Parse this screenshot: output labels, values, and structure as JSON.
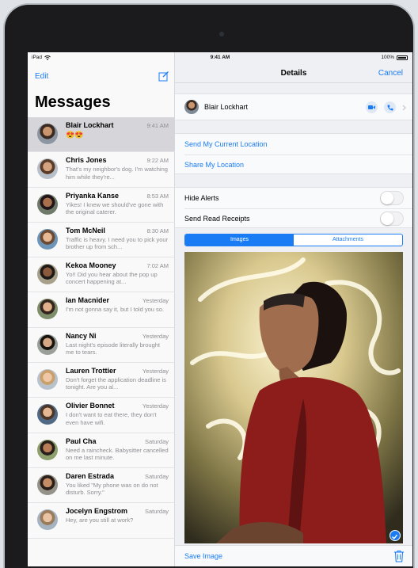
{
  "status_bar": {
    "device": "iPad",
    "time": "9:41 AM",
    "battery": "100%"
  },
  "sidebar": {
    "edit_label": "Edit",
    "title": "Messages",
    "conversations": [
      {
        "name": "Blair Lockhart",
        "time": "9:41 AM",
        "preview": "😍😍",
        "selected": true
      },
      {
        "name": "Chris Jones",
        "time": "9:22 AM",
        "preview": "That's my neighbor's dog. I'm watching him while they're..."
      },
      {
        "name": "Priyanka Kanse",
        "time": "8:53 AM",
        "preview": "Yikes! I knew we should've gone with the original caterer."
      },
      {
        "name": "Tom McNeil",
        "time": "8:30 AM",
        "preview": "Traffic is heavy. I need you to pick your brother up from sch..."
      },
      {
        "name": "Kekoa Mooney",
        "time": "7:02 AM",
        "preview": "Yo!! Did you hear about the pop up concert happening at..."
      },
      {
        "name": "Ian Macnider",
        "time": "Yesterday",
        "preview": "I'm not gonna say it, but I told you so."
      },
      {
        "name": "Nancy Ni",
        "time": "Yesterday",
        "preview": "Last night's episode literally brought me to tears."
      },
      {
        "name": "Lauren Trottier",
        "time": "Yesterday",
        "preview": "Don't forget the application deadline is tonight. Are you al..."
      },
      {
        "name": "Olivier Bonnet",
        "time": "Yesterday",
        "preview": "I don't want to eat there, they don't even have wifi."
      },
      {
        "name": "Paul Cha",
        "time": "Saturday",
        "preview": "Need a raincheck. Babysitter cancelled on me last minute."
      },
      {
        "name": "Daren Estrada",
        "time": "Saturday",
        "preview": "You liked \"My phone was on do not disturb. Sorry.\""
      },
      {
        "name": "Jocelyn Engstrom",
        "time": "Saturday",
        "preview": "Hey, are you still at work?"
      }
    ]
  },
  "details": {
    "title": "Details",
    "cancel_label": "Cancel",
    "contact_name": "Blair Lockhart",
    "send_location_label": "Send My Current Location",
    "share_location_label": "Share My Location",
    "hide_alerts_label": "Hide Alerts",
    "read_receipts_label": "Send Read Receipts",
    "tabs": [
      "Images",
      "Attachments"
    ],
    "active_tab": "Images",
    "save_image_label": "Save Image"
  },
  "colors": {
    "accent": "#1a7cf5",
    "selected_row": "#d6d6da"
  }
}
